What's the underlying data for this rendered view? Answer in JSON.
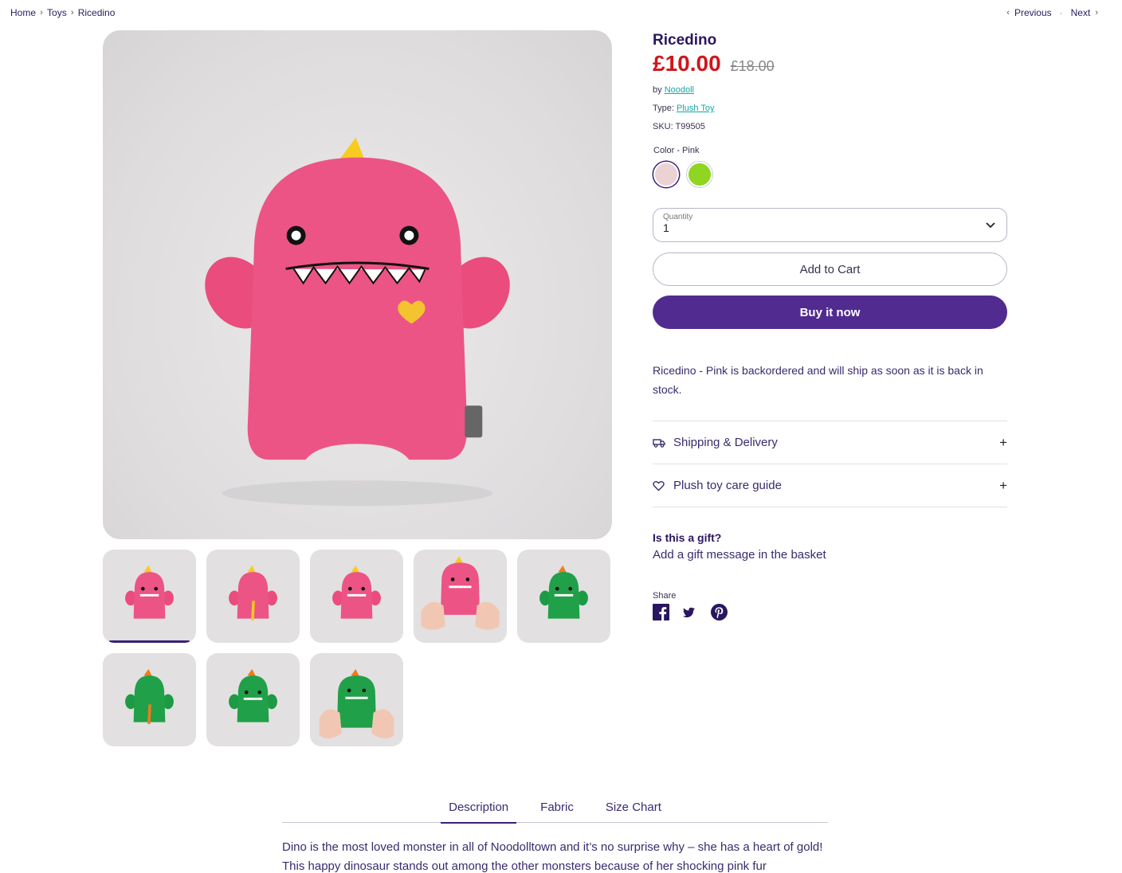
{
  "breadcrumb": {
    "items": [
      "Home",
      "Toys",
      "Ricedino"
    ],
    "previous": "Previous",
    "next": "Next"
  },
  "product": {
    "title": "Ricedino",
    "price": "£10.00",
    "compare_price": "£18.00",
    "vendor_prefix": "by ",
    "vendor": "Noodoll",
    "type_prefix": "Type: ",
    "type": "Plush Toy",
    "sku_line": "SKU: T99505",
    "color_label": "Color - Pink",
    "swatches": [
      {
        "name": "Pink",
        "color": "#ecd3d3",
        "selected": true
      },
      {
        "name": "Green",
        "color": "#8fd522",
        "selected": false
      }
    ],
    "quantity_label": "Quantity",
    "quantity_value": "1",
    "add_to_cart": "Add to Cart",
    "buy_now": "Buy it now",
    "backorder_message": "Ricedino - Pink is backordered and will ship as soon as it is back in stock."
  },
  "accordion": [
    {
      "label": "Shipping & Delivery",
      "icon": "truck-icon"
    },
    {
      "label": "Plush toy care guide",
      "icon": "heart-icon"
    }
  ],
  "gift": {
    "question": "Is this a gift?",
    "answer": "Add a gift message in the basket"
  },
  "share": {
    "label": "Share",
    "networks": [
      "facebook-icon",
      "twitter-icon",
      "pinterest-icon"
    ]
  },
  "gallery": {
    "thumbnails": [
      {
        "color": "pink",
        "view": "front",
        "active": true
      },
      {
        "color": "pink",
        "view": "back",
        "active": false
      },
      {
        "color": "pink",
        "view": "front",
        "active": false
      },
      {
        "color": "pink",
        "view": "held",
        "active": false
      },
      {
        "color": "green",
        "view": "front",
        "active": false
      },
      {
        "color": "green",
        "view": "back",
        "active": false
      },
      {
        "color": "green",
        "view": "front",
        "active": false
      },
      {
        "color": "green",
        "view": "held",
        "active": false
      }
    ]
  },
  "colors": {
    "accent": "#512b8f",
    "price_red": "#d0161b",
    "link_teal": "#1aa5a5",
    "plush_pink": "#ec5a86",
    "plush_green": "#20a048"
  },
  "tabs": [
    "Description",
    "Fabric",
    "Size Chart"
  ],
  "description": "Dino is the most loved monster in all of Noodolltown and it’s no surprise why – she has a heart of gold! This happy dinosaur stands out among the other monsters because of her shocking pink fur"
}
